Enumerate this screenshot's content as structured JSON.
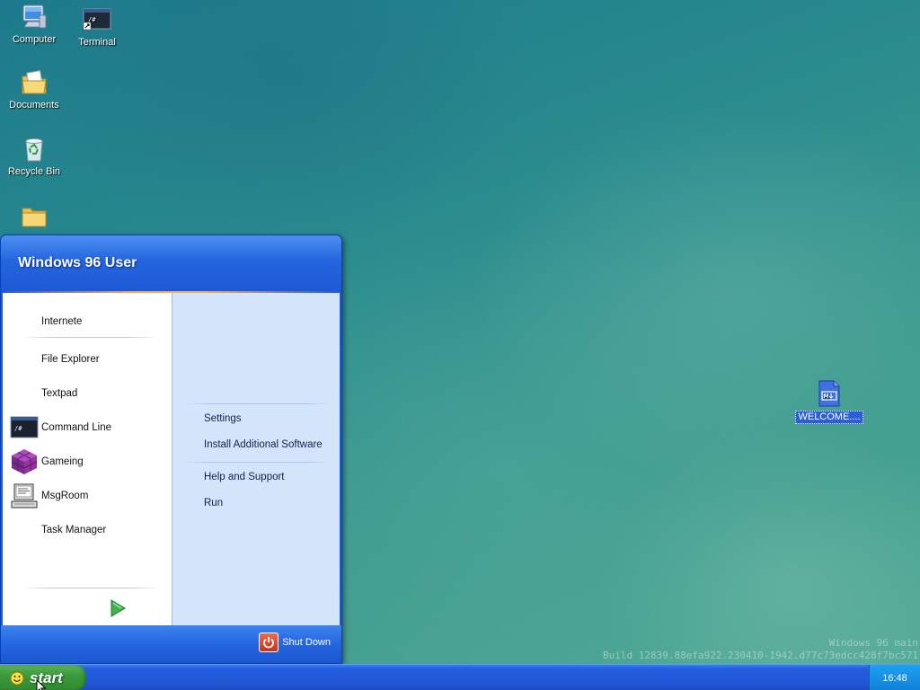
{
  "desktop": {
    "icons": [
      {
        "label": "Computer",
        "icon": "computer-icon"
      },
      {
        "label": "Terminal",
        "icon": "terminal-icon"
      },
      {
        "label": "Documents",
        "icon": "documents-folder-icon"
      },
      {
        "label": "Recycle Bin",
        "icon": "recycle-bin-icon"
      },
      {
        "label": "",
        "icon": "folder-icon"
      },
      {
        "label": "WELCOME....",
        "icon": "markdown-file-icon"
      }
    ]
  },
  "start_menu": {
    "user_name": "Windows 96 User",
    "left_items": [
      {
        "label": "Internete",
        "icon": ""
      },
      {
        "label": "File Explorer",
        "icon": ""
      },
      {
        "label": "Textpad",
        "icon": ""
      },
      {
        "label": "Command Line",
        "icon": "command-line-icon"
      },
      {
        "label": "Gameing",
        "icon": "gameing-cube-icon"
      },
      {
        "label": "MsgRoom",
        "icon": "msgroom-computer-icon"
      },
      {
        "label": "Task Manager",
        "icon": ""
      }
    ],
    "right_items": [
      {
        "label": "Settings"
      },
      {
        "label": "Install Additional Software"
      },
      {
        "label": "Help and Support"
      },
      {
        "label": "Run"
      }
    ],
    "all_programs_icon": "green-arrow-icon",
    "shutdown_label": "Shut Down"
  },
  "watermark": {
    "line1": "Windows 96 main",
    "line2": "Build 12839.88efa922.230410-1942.d77c73edcc428f7bc571"
  },
  "taskbar": {
    "start_label": "start",
    "clock": "16:48"
  },
  "colors": {
    "taskbar_blue": "#245ee0",
    "start_green": "#3c9a3c",
    "menu_right_panel": "#d3e5fa",
    "tray_blue": "#1690e4"
  }
}
